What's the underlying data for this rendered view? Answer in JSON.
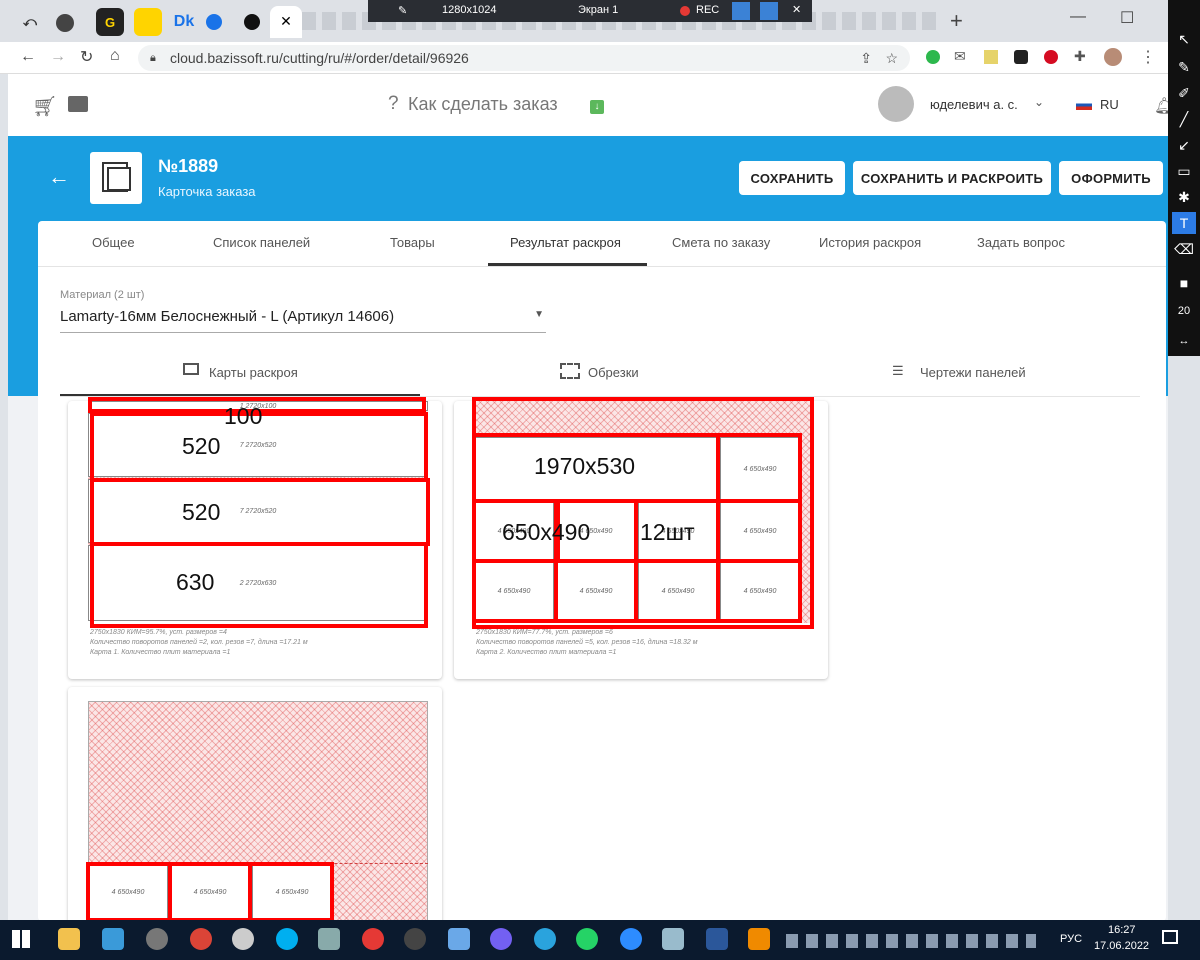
{
  "browser": {
    "url": "cloud.bazissoft.ru/cutting/ru/#/order/detail/96926",
    "favicons": [
      "G",
      "Dk"
    ]
  },
  "recorder": {
    "resolution": "1280x1024",
    "screen": "Экран 1",
    "rec": "REC"
  },
  "app_header": {
    "help": "Как сделать заказ",
    "user": "юделевич а. с.",
    "lang": "RU"
  },
  "order": {
    "number": "№1889",
    "subtitle": "Карточка заказа"
  },
  "buttons": {
    "save": "СОХРАНИТЬ",
    "save_cut": "СОХРАНИТЬ И РАСКРОИТЬ",
    "submit": "ОФОРМИТЬ"
  },
  "tabs": [
    "Общее",
    "Список панелей",
    "Товары",
    "Результат раскроя",
    "Смета по заказу",
    "История раскроя",
    "Задать вопрос"
  ],
  "material": {
    "label": "Материал (2 шт)",
    "value": "Lamarty-16мм Белоснежный - L (Артикул 14606)"
  },
  "subtabs": [
    "Карты раскроя",
    "Обрезки",
    "Чертежи панелей"
  ],
  "map1": {
    "panels": [
      "1 2720x100",
      "7 2720x520",
      "7 2720x520",
      "2 2720x630"
    ],
    "notes": [
      "100",
      "520",
      "520",
      "630"
    ],
    "info": [
      "2750x1830 КИМ=95.7%, уст. размеров =4",
      "Количество поворотов панелей =2, кол. резов =7, длина =17.21 м",
      "Карта 1. Количество плит материала =1"
    ]
  },
  "map2": {
    "panels": [
      "4 650x490"
    ],
    "notes": [
      "1970x530",
      "650x490",
      "12шт"
    ],
    "info": [
      "2750x1830 КИМ=77.7%, уст. размеров =6",
      "Количество поворотов панелей =5, кол. резов =16, длина =18.32 м",
      "Карта 2. Количество плит материала =1"
    ]
  },
  "map3": {
    "panels": [
      "4 650x490",
      "4 650x490",
      "4 650x490"
    ]
  },
  "taskbar": {
    "lang": "РУС",
    "time": "16:27",
    "date": "17.06.2022"
  },
  "sidebar": {
    "size": "20"
  }
}
